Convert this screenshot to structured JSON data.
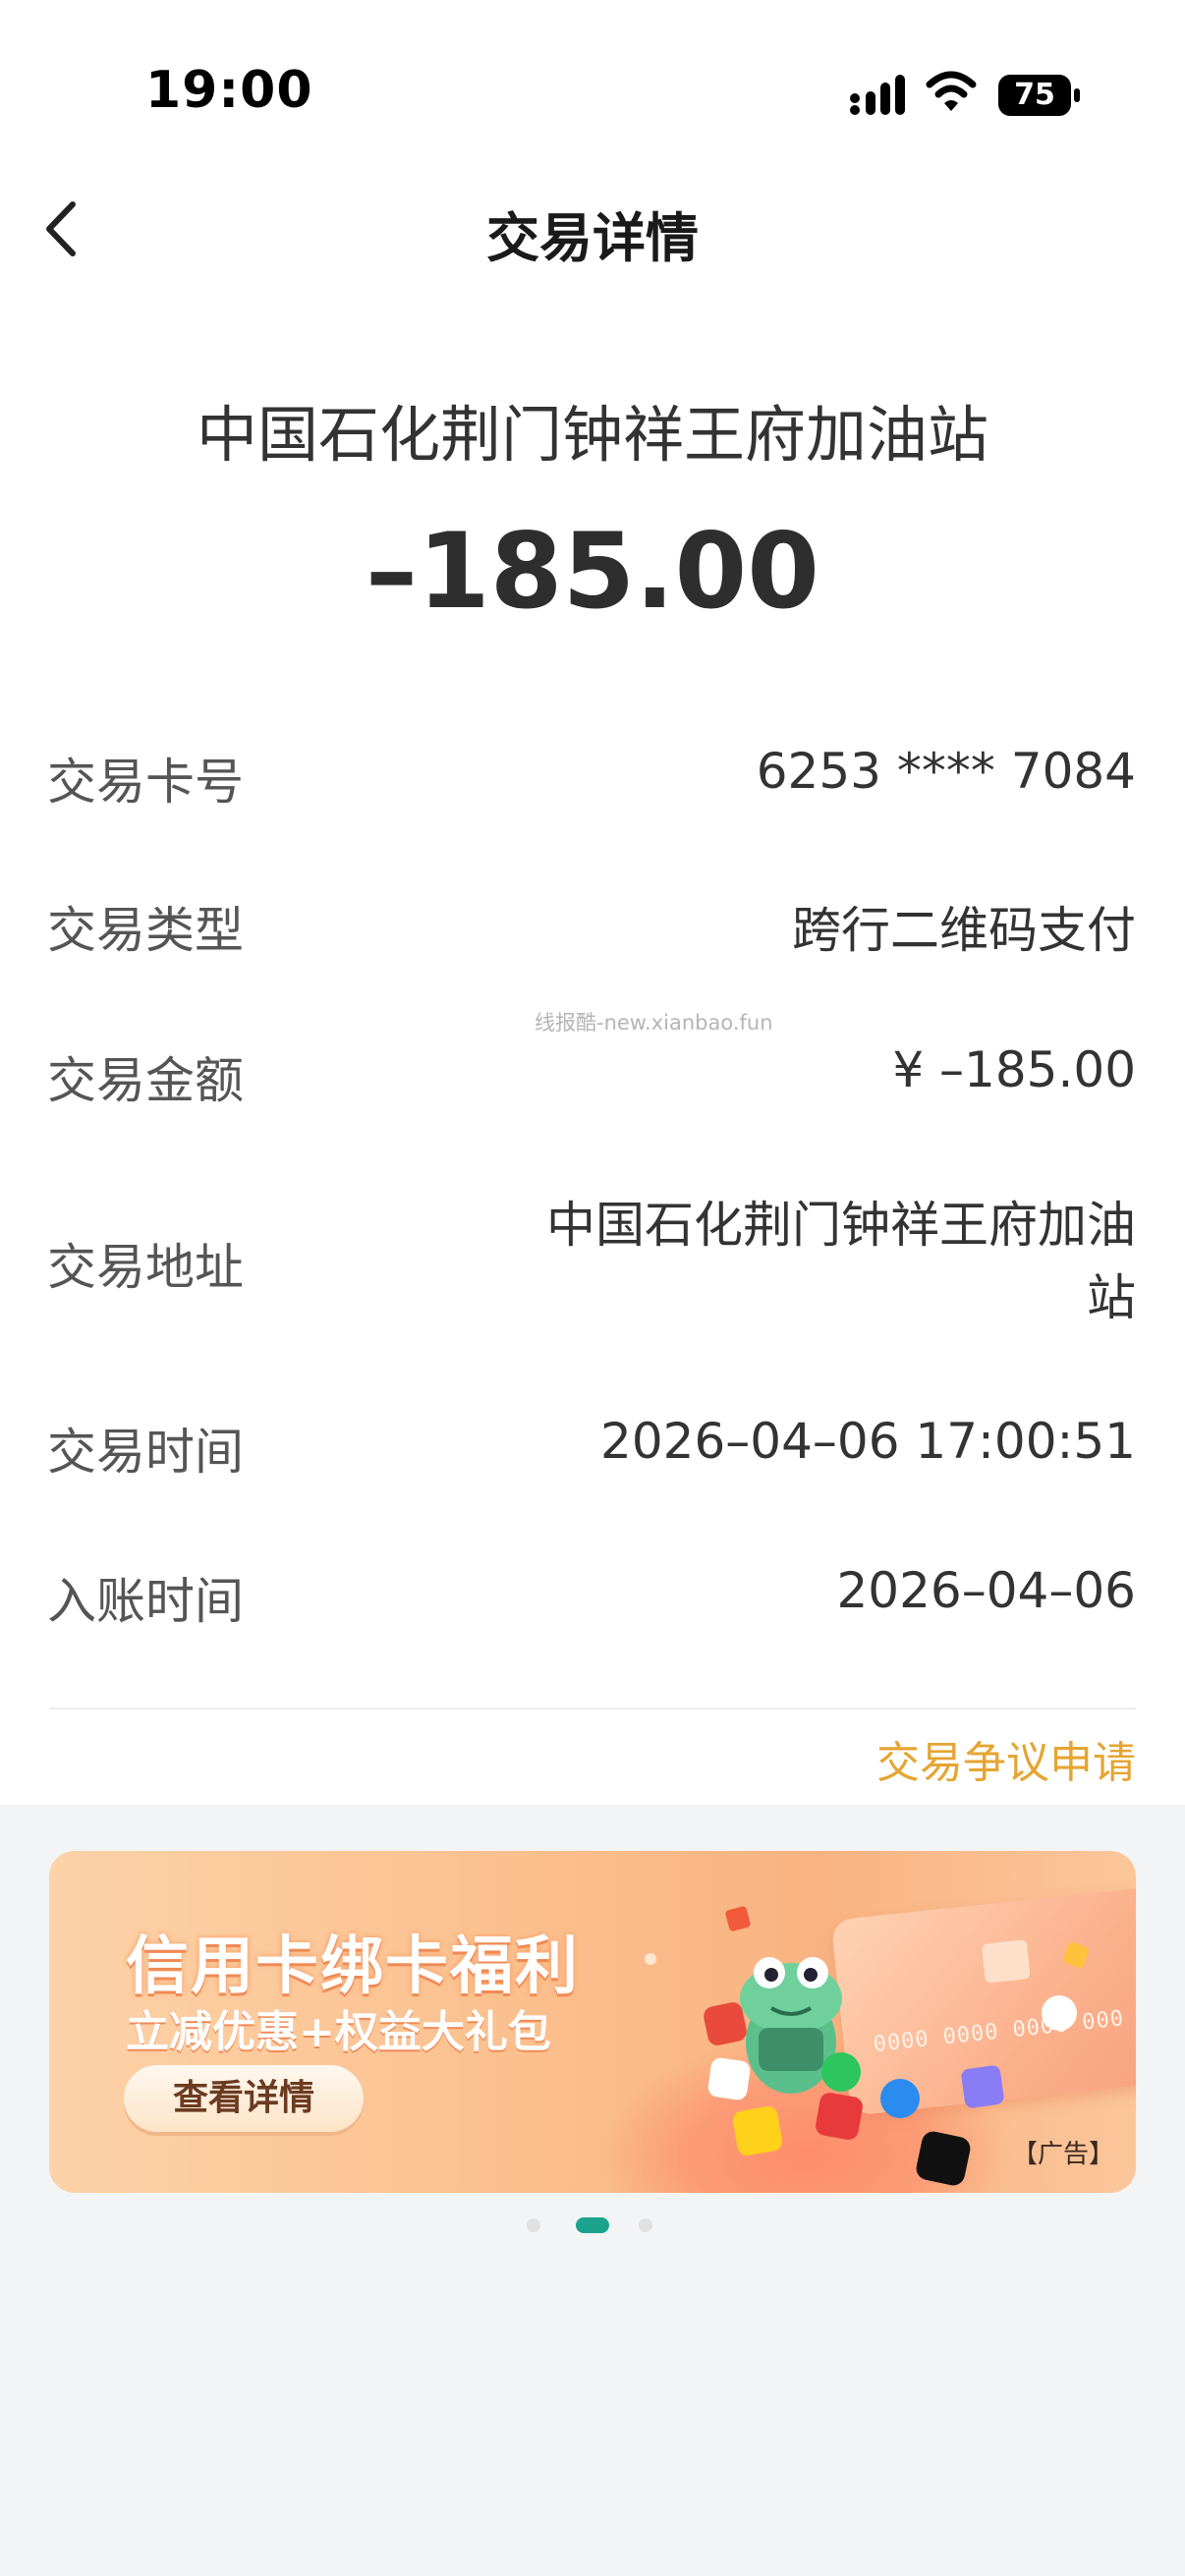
{
  "status_bar": {
    "time": "19:00",
    "battery": "75"
  },
  "nav": {
    "title": "交易详情",
    "back_icon": "chevron-left-icon"
  },
  "header": {
    "merchant": "中国石化荆门钟祥王府加油站",
    "amount": "–185.00"
  },
  "details": [
    {
      "label": "交易卡号",
      "value": "6253 **** 7084"
    },
    {
      "label": "交易类型",
      "value": "跨行二维码支付"
    },
    {
      "label": "交易金额",
      "value": "¥ –185.00"
    },
    {
      "label": "交易地址",
      "value": "中国石化荆门钟祥王府加油站"
    },
    {
      "label": "交易时间",
      "value": "2026–04–06 17:00:51"
    },
    {
      "label": "入账时间",
      "value": "2026–04–06"
    }
  ],
  "watermark": "线报酷-new.xianbao.fun",
  "dispute_link": "交易争议申请",
  "banner": {
    "title": "信用卡绑卡福利",
    "subtitle": "立减优惠+权益大礼包",
    "button": "查看详情",
    "card_number": "0000 0000 0000 000",
    "ad_tag": "【广告】"
  },
  "carousel": {
    "count": 3,
    "active_index": 1
  },
  "colors": {
    "accent_orange": "#e5a532",
    "dot_active": "#1aa48e"
  }
}
